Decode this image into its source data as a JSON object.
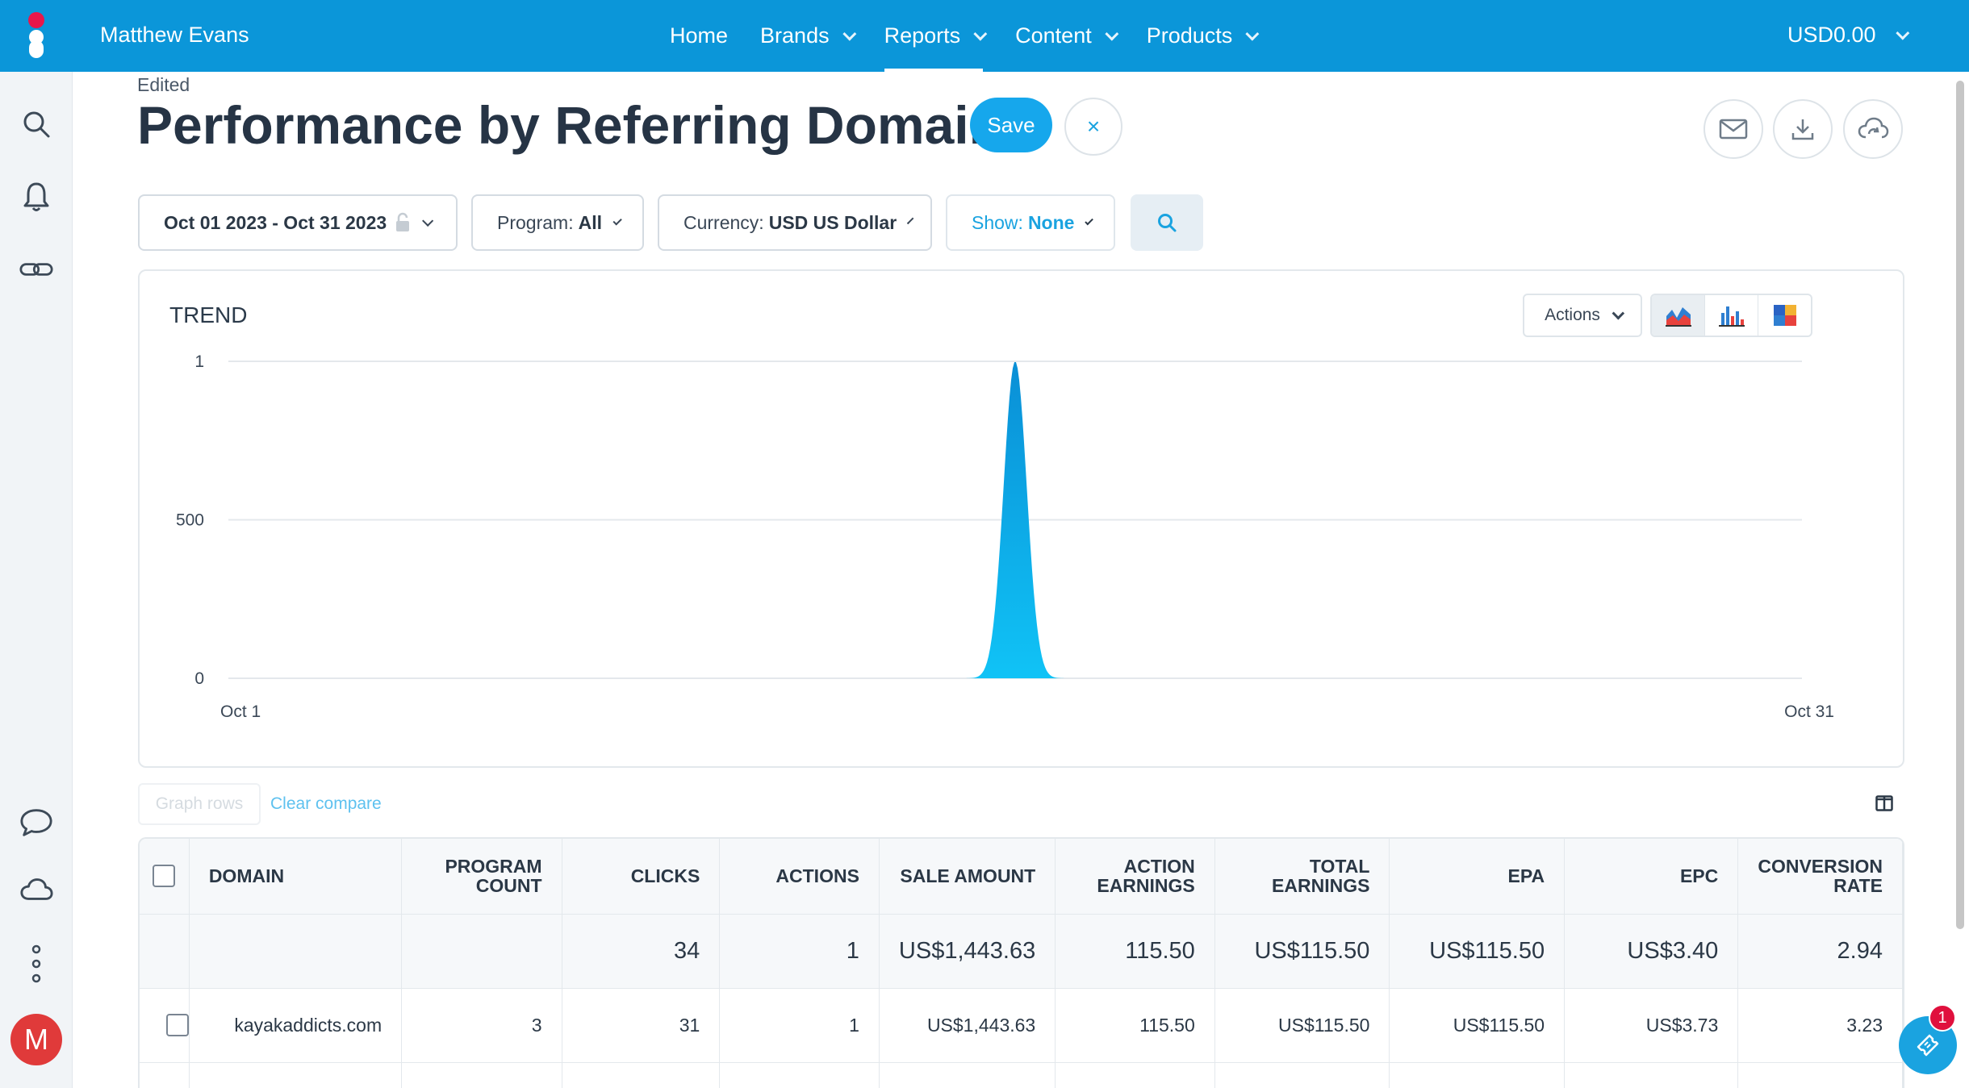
{
  "topbar": {
    "user_name": "Matthew Evans",
    "nav": [
      {
        "label": "Home",
        "has_dropdown": false,
        "active": false
      },
      {
        "label": "Brands",
        "has_dropdown": true,
        "active": false
      },
      {
        "label": "Reports",
        "has_dropdown": true,
        "active": true
      },
      {
        "label": "Content",
        "has_dropdown": true,
        "active": false
      },
      {
        "label": "Products",
        "has_dropdown": true,
        "active": false
      }
    ],
    "balance": "USD0.00",
    "color": "#0b96d9"
  },
  "sidebar": {
    "icons": [
      "search-icon",
      "bell-icon",
      "link-icon",
      "chat-icon",
      "cloud-icon",
      "more-icon"
    ],
    "avatar_letter": "M"
  },
  "header": {
    "status": "Edited",
    "title": "Performance by Referring Domain",
    "save_label": "Save",
    "close_symbol": "×",
    "right_icons": [
      "email-icon",
      "download-icon",
      "cloud-sync-icon"
    ]
  },
  "filters": {
    "date_range": "Oct 01 2023 - Oct 31 2023",
    "program_label": "Program:",
    "program_value": "All",
    "currency_label": "Currency:",
    "currency_value": "USD US Dollar",
    "show_label": "Show:",
    "show_value": "None"
  },
  "chart": {
    "title": "TREND",
    "actions_label": "Actions",
    "chart_types": [
      "area-chart-icon",
      "bar-chart-icon",
      "heatmap-icon"
    ],
    "active_type": "area-chart-icon"
  },
  "chart_data": {
    "type": "area",
    "title": "TREND",
    "x_start_label": "Oct 1",
    "x_end_label": "Oct 31",
    "x_tick_labels": [
      "Oct 1",
      "Oct 31"
    ],
    "y_tick_labels": [
      "0",
      "500",
      "1"
    ],
    "y_tick_values": [
      0,
      500,
      1000
    ],
    "ylim": [
      0,
      1000
    ],
    "series": [
      {
        "values": [
          0,
          0,
          0,
          0,
          0,
          0,
          0,
          0,
          0,
          0,
          0,
          0,
          0,
          0,
          0,
          1000,
          0,
          0,
          0,
          0,
          0,
          0,
          0,
          0,
          0,
          0,
          0,
          0,
          0,
          0,
          0
        ],
        "color": "#0aa6e6"
      }
    ],
    "grid": true
  },
  "compare": {
    "graph_rows_label": "Graph rows",
    "clear_compare_label": "Clear compare"
  },
  "table": {
    "columns": [
      "DOMAIN",
      "PROGRAM COUNT",
      "CLICKS",
      "ACTIONS",
      "SALE AMOUNT",
      "ACTION EARNINGS",
      "TOTAL EARNINGS",
      "EPA",
      "EPC",
      "CONVERSION RATE"
    ],
    "totals": [
      "",
      "",
      "34",
      "1",
      "US$1,443.63",
      "115.50",
      "US$115.50",
      "US$115.50",
      "US$3.40",
      "2.94"
    ],
    "rows": [
      [
        "kayakaddicts.com",
        "3",
        "31",
        "1",
        "US$1,443.63",
        "115.50",
        "US$115.50",
        "US$115.50",
        "US$3.73",
        "3.23"
      ]
    ]
  },
  "help": {
    "badge_count": "1"
  }
}
